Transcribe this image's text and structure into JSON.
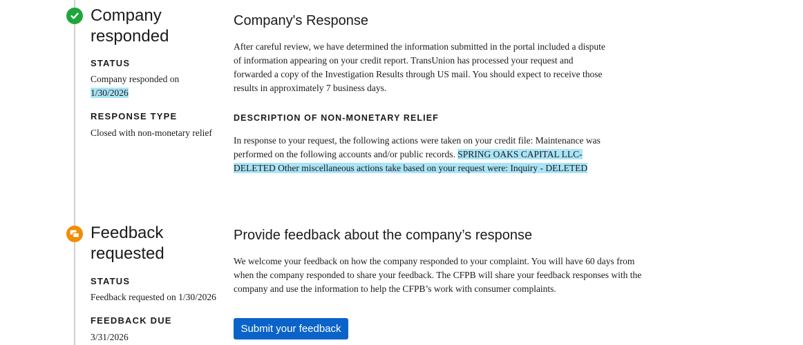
{
  "steps": {
    "responded": {
      "title": "Company responded",
      "status_label": "STATUS",
      "status_text": "Company responded on",
      "status_date": "1/30/2026",
      "response_type_label": "RESPONSE TYPE",
      "response_type_value": "Closed with non-monetary relief"
    },
    "feedback": {
      "title": "Feedback requested",
      "status_label": "STATUS",
      "status_value": "Feedback requested on 1/30/2026",
      "due_label": "FEEDBACK DUE",
      "due_value": "3/31/2026"
    }
  },
  "response": {
    "heading": "Company's Response",
    "paragraph": "After careful review, we have determined the information submitted in the portal included a dispute of information appearing on your credit report. TransUnion has processed your request and forwarded a copy of the Investigation Results through US mail. You should expect to receive those results in approximately 7 business days.",
    "relief_heading": "DESCRIPTION OF NON-MONETARY RELIEF",
    "relief_text": "In response to your request, the following actions were taken on your credit file: Maintenance was performed on the following accounts and/or public records.",
    "relief_highlight": "SPRING OAKS CAPITAL LLC-DELETED Other miscellaneous actions take based on your request were: Inquiry - DELETED"
  },
  "feedback_section": {
    "heading": "Provide feedback about the company’s response",
    "paragraph": "We welcome your feedback on how the company responded to your complaint. You will have 60 days from when the company responded to share your feedback. The CFPB will share your feedback responses with the company and use the information to help the CFPB’s work with consumer complaints.",
    "button_label": "Submit your feedback"
  },
  "colors": {
    "done_icon": "#1ea63a",
    "feedback_icon": "#f28c00",
    "primary_button": "#0a63c9",
    "highlight": "#64cdf0"
  },
  "icons": {
    "responded": "check-circle-icon",
    "feedback": "chat-bubbles-icon"
  }
}
